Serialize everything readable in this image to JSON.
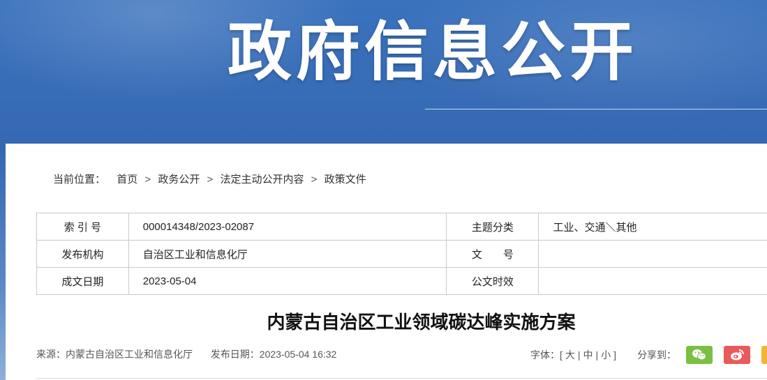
{
  "banner": {
    "title": "政府信息公开"
  },
  "breadcrumb": {
    "label": "当前位置：",
    "items": [
      "首页",
      "政务公开",
      "法定主动公开内容",
      "政策文件"
    ],
    "separator": ">"
  },
  "meta_table": {
    "rows": [
      {
        "k1": "索 引 号",
        "v1": "000014348/2023-02087",
        "k2": "主题分类",
        "v2": "工业、交通＼其他"
      },
      {
        "k1": "发布机构",
        "v1": "自治区工业和信息化厅",
        "k2": "文　　号",
        "v2": ""
      },
      {
        "k1": "成文日期",
        "v1": "2023-05-04",
        "k2": "公文时效",
        "v2": ""
      }
    ]
  },
  "document": {
    "title": "内蒙古自治区工业领域碳达峰实施方案",
    "source": "来源：内蒙古自治区工业和信息化厅",
    "publish_date": "发布日期：2023-05-04 16:32"
  },
  "tools": {
    "font_label": "字体：[",
    "font_large": "大",
    "font_medium": "中",
    "font_small": "小",
    "font_sep": "|",
    "font_close": "]",
    "share_label": "分享到：",
    "share": [
      {
        "name": "wechat",
        "color": "#79c043"
      },
      {
        "name": "weibo",
        "color": "#ea5a5a"
      },
      {
        "name": "favorite",
        "color": "#f2b23c"
      }
    ]
  }
}
